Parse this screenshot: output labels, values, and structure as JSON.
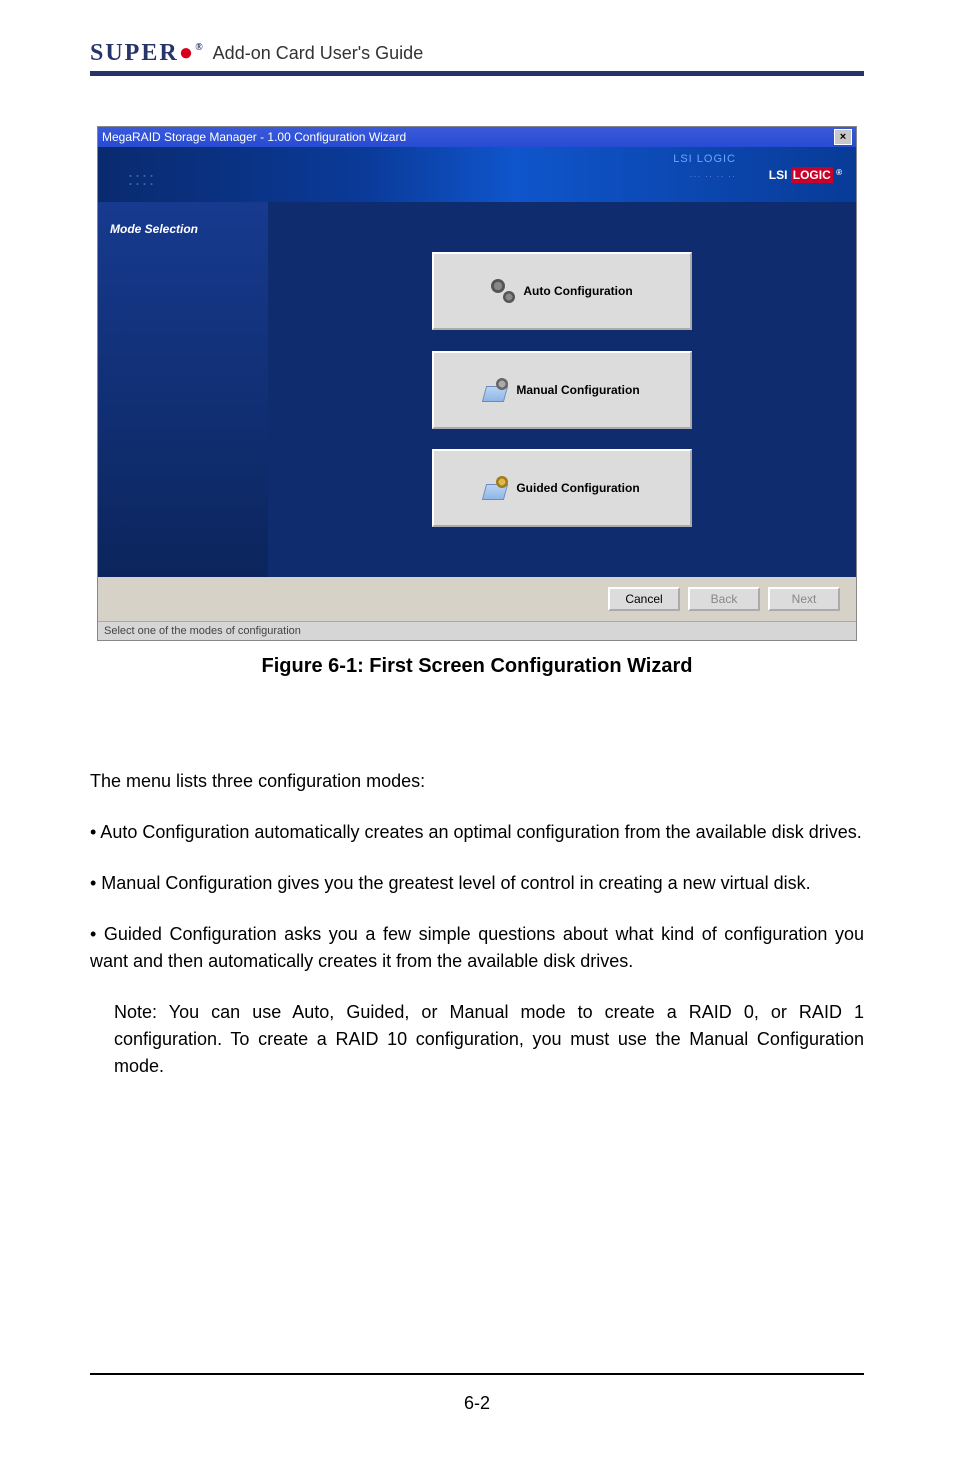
{
  "header": {
    "logo_text": "SUPER",
    "logo_reg": "®",
    "title": "Add-on Card User's Guide"
  },
  "wizard": {
    "title": "MegaRAID Storage Manager - 1.00 Configuration Wizard",
    "brand_prefix": "LSI",
    "brand_box": "LOGIC",
    "brand_reg": "®",
    "banner_stamp": "LSI LOGIC",
    "side_label": "Mode Selection",
    "buttons": {
      "auto": "Auto Configuration",
      "manual": "Manual Configuration",
      "guided": "Guided Configuration"
    },
    "footer": {
      "cancel": "Cancel",
      "back": "Back",
      "next": "Next"
    },
    "status": "Select one of the modes of configuration"
  },
  "figure_caption": "Figure 6-1: First Screen Configuration Wizard",
  "body": {
    "intro": "The menu lists three configuration modes:",
    "bullet1": "• Auto Configuration automatically creates an optimal configuration from the available disk drives.",
    "bullet2": "• Manual Configuration gives you the greatest level of control in creating a new virtual disk.",
    "bullet3": "• Guided Configuration asks you a few simple questions about what kind of configuration you want and then automatically creates it from the available disk drives.",
    "note": "Note: You can use Auto, Guided, or Manual mode to create a RAID 0, or RAID 1 configuration. To create a RAID 10 configuration, you must use the Manual Configuration mode."
  },
  "page_number": "6-2"
}
